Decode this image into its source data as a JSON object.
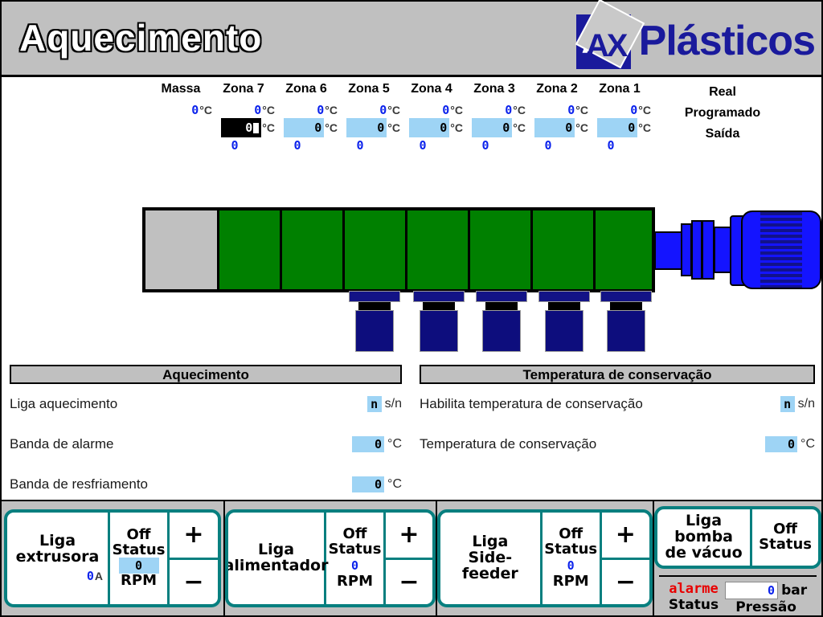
{
  "header": {
    "title": "Aquecimento",
    "logo_mark": "AX",
    "logo_text": "Plásticos"
  },
  "zones": {
    "row_labels": [
      "Real",
      "Programado",
      "Saída"
    ],
    "columns": [
      {
        "name": "Massa",
        "real": "0",
        "real_unit": "°C",
        "programado": null,
        "prog_unit": "",
        "saida": null,
        "selected": false
      },
      {
        "name": "Zona 7",
        "real": "0",
        "real_unit": "°C",
        "programado": "0",
        "prog_unit": "°C",
        "saida": "0",
        "selected": true
      },
      {
        "name": "Zona 6",
        "real": "0",
        "real_unit": "°C",
        "programado": "0",
        "prog_unit": "°C",
        "saida": "0",
        "selected": false
      },
      {
        "name": "Zona 5",
        "real": "0",
        "real_unit": "°C",
        "programado": "0",
        "prog_unit": "°C",
        "saida": "0",
        "selected": false
      },
      {
        "name": "Zona 4",
        "real": "0",
        "real_unit": "°C",
        "programado": "0",
        "prog_unit": "°C",
        "saida": "0",
        "selected": false
      },
      {
        "name": "Zona 3",
        "real": "0",
        "real_unit": "°C",
        "programado": "0",
        "prog_unit": "°C",
        "saida": "0",
        "selected": false
      },
      {
        "name": "Zona 2",
        "real": "0",
        "real_unit": "°C",
        "programado": "0",
        "prog_unit": "°C",
        "saida": "0",
        "selected": false
      },
      {
        "name": "Zona 1",
        "real": "0",
        "real_unit": "°C",
        "programado": "0",
        "prog_unit": "°C",
        "saida": "0",
        "selected": false
      }
    ]
  },
  "machine": {
    "segments": [
      "hopper",
      "zone",
      "zone",
      "zone",
      "zone",
      "zone",
      "zone",
      "zone"
    ],
    "heater_count": 5,
    "colors": {
      "hopper": "#c0c0c0",
      "barrel": "#008000",
      "heater": "#0d0d7d",
      "motor": "#1414ff"
    }
  },
  "panel_heating": {
    "title": "Aquecimento",
    "rows": [
      {
        "label": "Liga aquecimento",
        "value": "n",
        "unit": "s/n",
        "kind": "flag"
      },
      {
        "label": "Banda de alarme",
        "value": "0",
        "unit": "°C",
        "kind": "num"
      },
      {
        "label": "Banda de resfriamento",
        "value": "0",
        "unit": "°C",
        "kind": "num"
      }
    ]
  },
  "panel_conservation": {
    "title": "Temperatura de conservação",
    "rows": [
      {
        "label": "Habilita temperatura de conservação",
        "value": "n",
        "unit": "s/n",
        "kind": "flag"
      },
      {
        "label": "Temperatura de conservação",
        "value": "0",
        "unit": "°C",
        "kind": "num"
      }
    ]
  },
  "controls": [
    {
      "label_line1": "Liga",
      "label_line2": "extrusora",
      "current": "0",
      "current_unit": "A",
      "status_value": "Off",
      "status_label": "Status",
      "rpm_value": "0",
      "rpm_label": "RPM",
      "rpm_editable": true,
      "plus": "+",
      "minus": "−"
    },
    {
      "label_line1": "Liga",
      "label_line2": "alimentador",
      "current": null,
      "current_unit": "",
      "status_value": "Off",
      "status_label": "Status",
      "rpm_value": "0",
      "rpm_label": "RPM",
      "rpm_editable": false,
      "plus": "+",
      "minus": "−"
    },
    {
      "label_line1": "Liga",
      "label_line2": "Side-feeder",
      "current": null,
      "current_unit": "",
      "status_value": "Off",
      "status_label": "Status",
      "rpm_value": "0",
      "rpm_label": "RPM",
      "rpm_editable": false,
      "plus": "+",
      "minus": "−"
    }
  ],
  "vacuum": {
    "label_line1": "Liga bomba",
    "label_line2": "de vácuo",
    "status_value": "Off",
    "status_label": "Status",
    "alarm_text": "alarme",
    "alarm_label": "Status",
    "pressure_value": "0",
    "pressure_unit": "bar",
    "pressure_label": "Pressão"
  },
  "colors": {
    "accent_teal": "#077f7f",
    "value_blue": "#0b22ec",
    "input_blue": "#9ed4f5",
    "alarm_red": "#e80000",
    "brand_blue": "#1a1a9c"
  }
}
